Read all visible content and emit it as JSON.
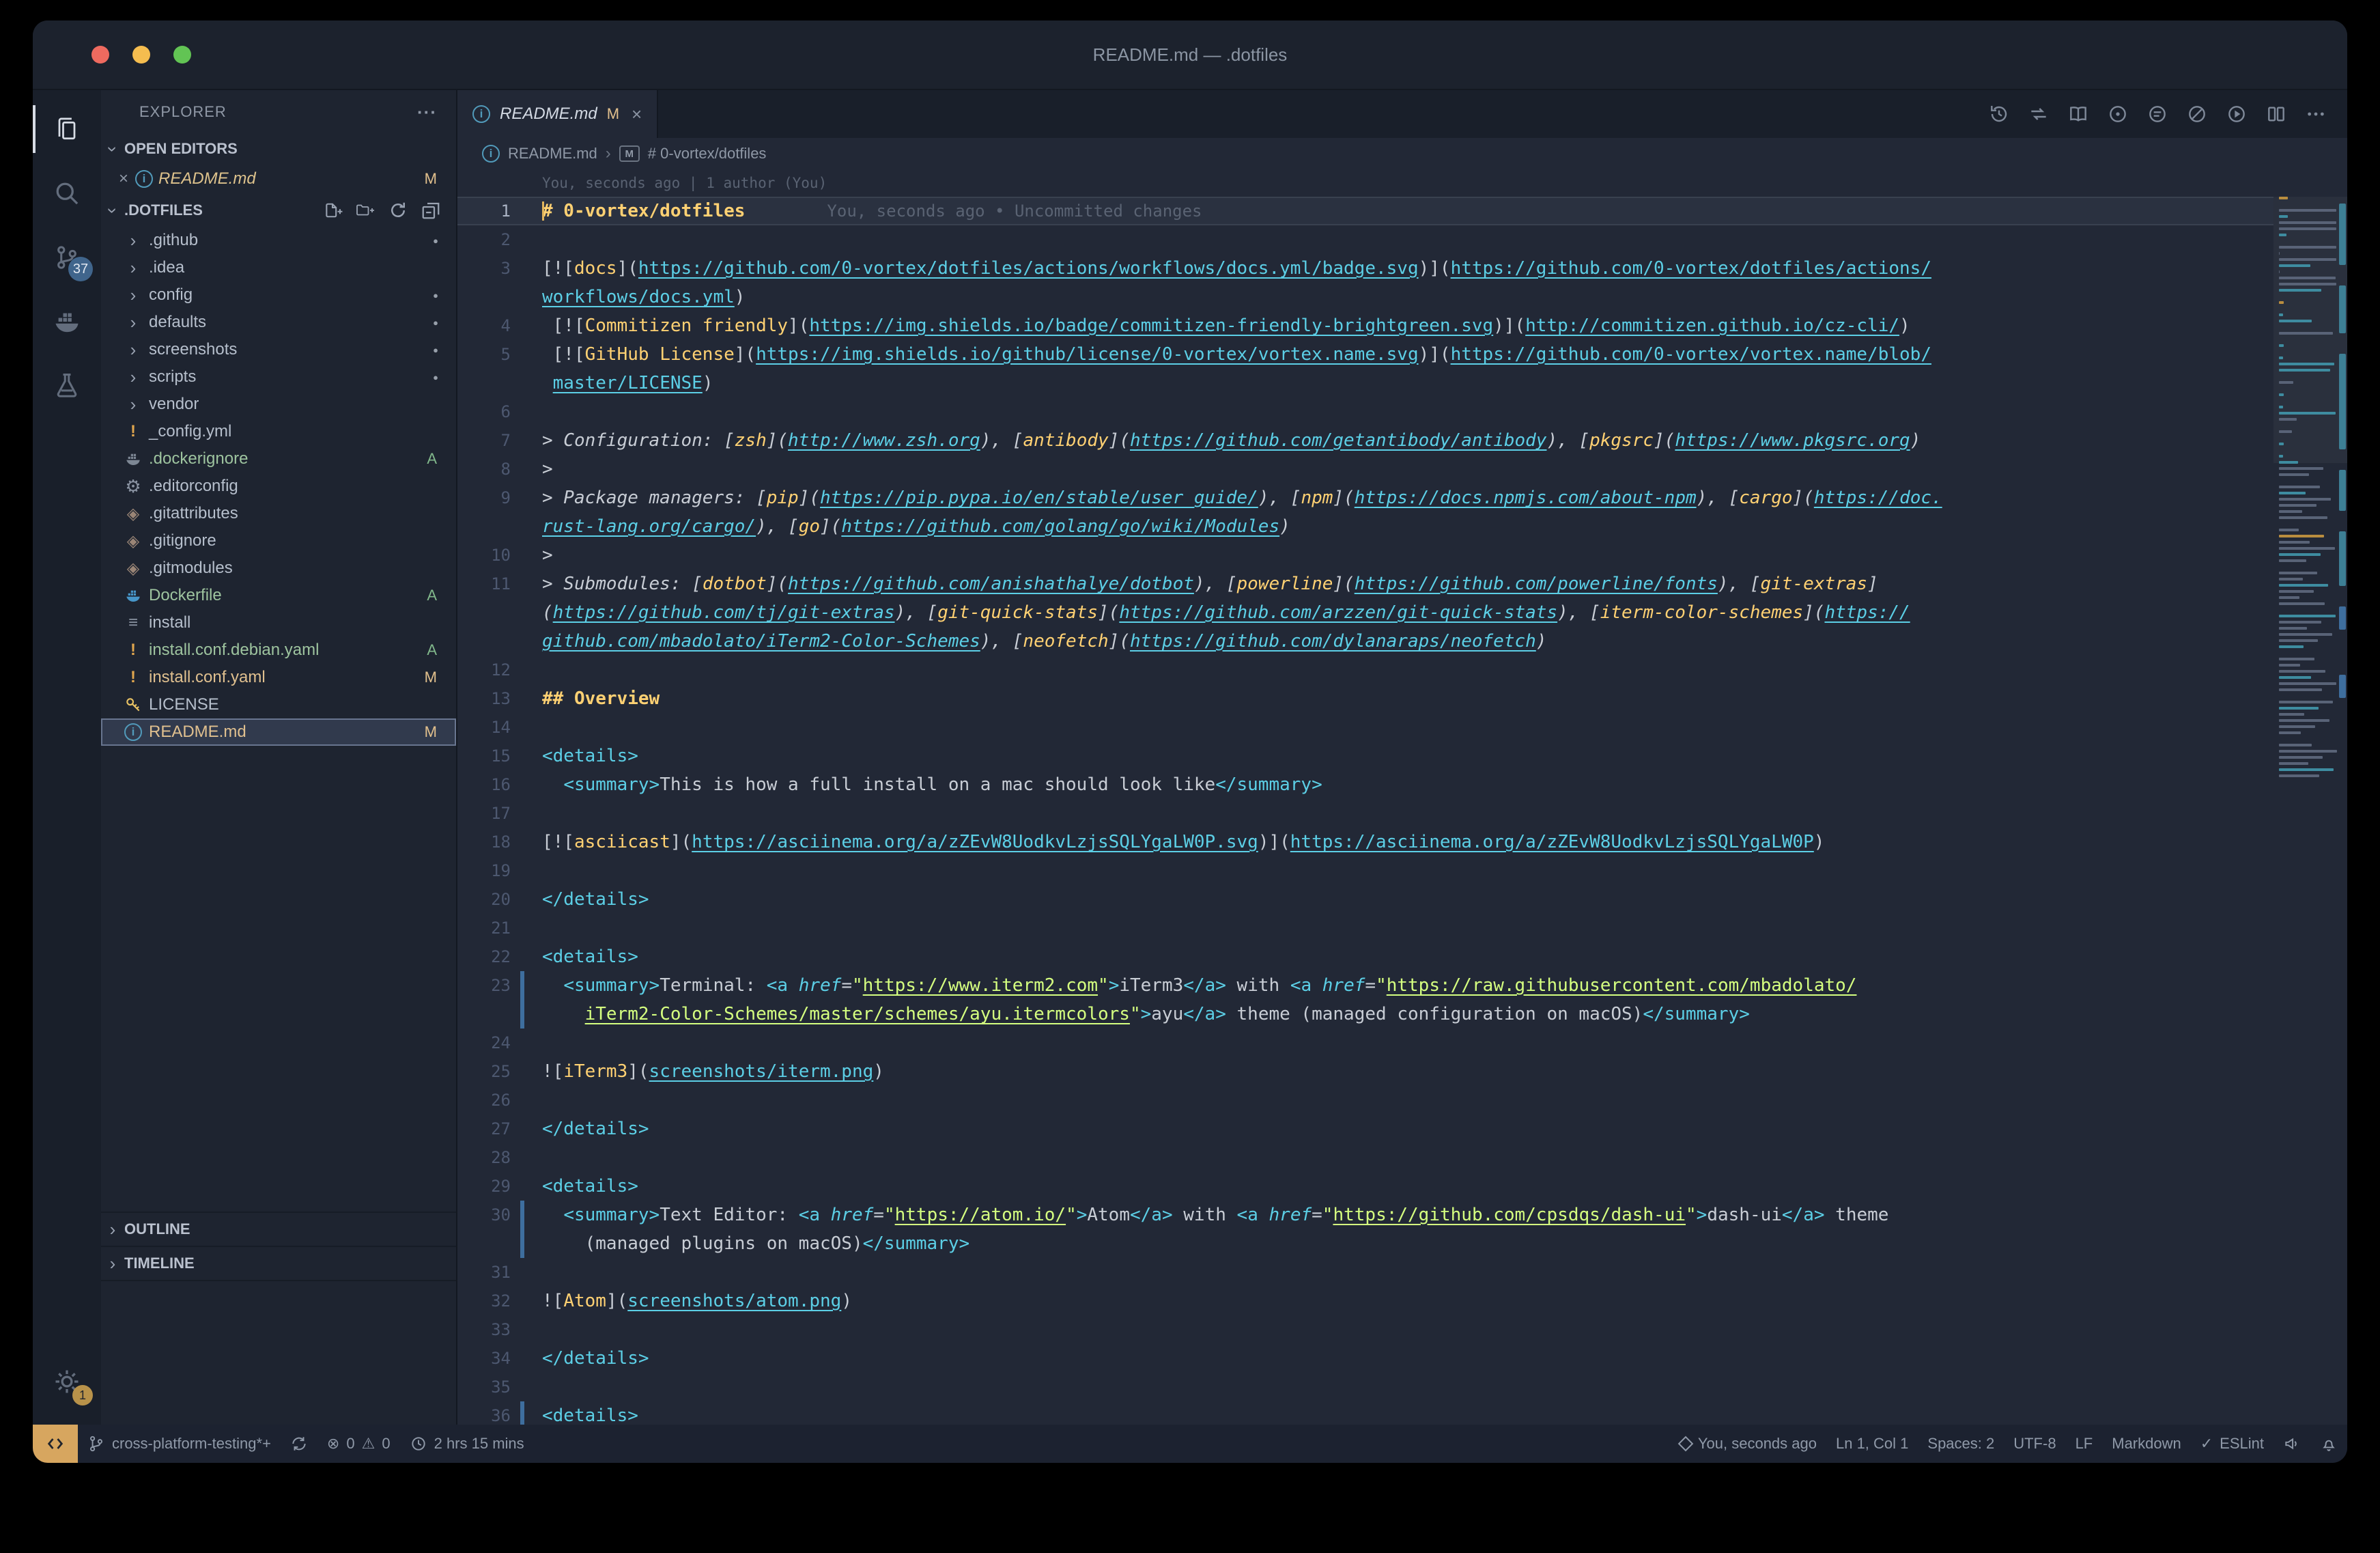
{
  "window": {
    "title": "README.md — .dotfiles"
  },
  "activity_bar": {
    "scm_badge": "37",
    "settings_badge": "1"
  },
  "sidebar": {
    "title": "EXPLORER",
    "more": "···",
    "sections": {
      "open_editors": "OPEN EDITORS",
      "folder": ".DOTFILES",
      "outline": "OUTLINE",
      "timeline": "TIMELINE"
    },
    "open_editor": {
      "name": "README.md",
      "badge": "M"
    },
    "tree": [
      {
        "label": ".github",
        "type": "folder",
        "dot": true
      },
      {
        "label": ".idea",
        "type": "folder"
      },
      {
        "label": "config",
        "type": "folder",
        "dot": true
      },
      {
        "label": "defaults",
        "type": "folder",
        "dot": true
      },
      {
        "label": "screenshots",
        "type": "folder",
        "dot": true
      },
      {
        "label": "scripts",
        "type": "folder",
        "dot": true
      },
      {
        "label": "vendor",
        "type": "folder"
      },
      {
        "label": "_config.yml",
        "icon": "yaml"
      },
      {
        "label": ".dockerignore",
        "icon": "docker-gray",
        "badge": "A"
      },
      {
        "label": ".editorconfig",
        "icon": "gear"
      },
      {
        "label": ".gitattributes",
        "icon": "git"
      },
      {
        "label": ".gitignore",
        "icon": "git"
      },
      {
        "label": ".gitmodules",
        "icon": "git"
      },
      {
        "label": "Dockerfile",
        "icon": "docker-blue",
        "badge": "A"
      },
      {
        "label": "install",
        "icon": "shell"
      },
      {
        "label": "install.conf.debian.yaml",
        "icon": "yaml",
        "badge": "A"
      },
      {
        "label": "install.conf.yaml",
        "icon": "yaml",
        "badge": "M"
      },
      {
        "label": "LICENSE",
        "icon": "key"
      },
      {
        "label": "README.md",
        "icon": "info",
        "badge": "M",
        "selected": true
      }
    ]
  },
  "editor": {
    "tab": {
      "title": "README.md",
      "badge": "M"
    },
    "breadcrumbs": {
      "file": "README.md",
      "heading": "# 0-vortex/dotfiles"
    },
    "blame_header": "You, seconds ago | 1 author (You)",
    "rows": [
      {
        "n": "1",
        "cur": true,
        "blame": "You, seconds ago • Uncommitted changes",
        "t": [
          [
            "h",
            "# 0-vortex/dotfiles"
          ]
        ]
      },
      {
        "n": "2",
        "t": []
      },
      {
        "n": "3",
        "t": [
          [
            "p",
            "[!["
          ],
          [
            "y",
            "docs"
          ],
          [
            "p",
            "]("
          ],
          [
            "u",
            "https://github.com/0-vortex/dotfiles/actions/workflows/docs.yml/badge.svg"
          ],
          [
            "p",
            ")]("
          ],
          [
            "u",
            "https://github.com/0-vortex/dotfiles/actions/"
          ]
        ]
      },
      {
        "n": "",
        "t": [
          [
            "u",
            "workflows/docs.yml"
          ],
          [
            "p",
            ")"
          ]
        ]
      },
      {
        "n": "4",
        "t": [
          [
            "p",
            " [!["
          ],
          [
            "y",
            "Commitizen friendly"
          ],
          [
            "p",
            "]("
          ],
          [
            "u",
            "https://img.shields.io/badge/commitizen-friendly-brightgreen.svg"
          ],
          [
            "p",
            ")]("
          ],
          [
            "u",
            "http://commitizen.github.io/cz-cli/"
          ],
          [
            "p",
            ")"
          ]
        ]
      },
      {
        "n": "5",
        "t": [
          [
            "p",
            " [!["
          ],
          [
            "y",
            "GitHub License"
          ],
          [
            "p",
            "]("
          ],
          [
            "u",
            "https://img.shields.io/github/license/0-vortex/vortex.name.svg"
          ],
          [
            "p",
            ")]("
          ],
          [
            "u",
            "https://github.com/0-vortex/vortex.name/blob/"
          ]
        ]
      },
      {
        "n": "",
        "t": [
          [
            "p",
            " "
          ],
          [
            "u",
            "master/LICENSE"
          ],
          [
            "p",
            ")"
          ]
        ]
      },
      {
        "n": "6",
        "t": []
      },
      {
        "n": "7",
        "q": true,
        "t": [
          [
            "p",
            "> Configuration: ["
          ],
          [
            "y",
            "zsh"
          ],
          [
            "p",
            "]("
          ],
          [
            "u",
            "http://www.zsh.org"
          ],
          [
            "p",
            "), ["
          ],
          [
            "y",
            "antibody"
          ],
          [
            "p",
            "]("
          ],
          [
            "u",
            "https://github.com/getantibody/antibody"
          ],
          [
            "p",
            "), ["
          ],
          [
            "y",
            "pkgsrc"
          ],
          [
            "p",
            "]("
          ],
          [
            "u",
            "https://www.pkgsrc.org"
          ],
          [
            "p",
            ")"
          ]
        ]
      },
      {
        "n": "8",
        "q": true,
        "t": [
          [
            "p",
            ">"
          ]
        ]
      },
      {
        "n": "9",
        "q": true,
        "t": [
          [
            "p",
            "> Package managers: ["
          ],
          [
            "y",
            "pip"
          ],
          [
            "p",
            "]("
          ],
          [
            "u",
            "https://pip.pypa.io/en/stable/user_guide/"
          ],
          [
            "p",
            "), ["
          ],
          [
            "y",
            "npm"
          ],
          [
            "p",
            "]("
          ],
          [
            "u",
            "https://docs.npmjs.com/about-npm"
          ],
          [
            "p",
            "), ["
          ],
          [
            "y",
            "cargo"
          ],
          [
            "p",
            "]("
          ],
          [
            "u",
            "https://doc."
          ]
        ]
      },
      {
        "n": "",
        "q": true,
        "t": [
          [
            "u",
            "rust-lang.org/cargo/"
          ],
          [
            "p",
            "), ["
          ],
          [
            "y",
            "go"
          ],
          [
            "p",
            "]("
          ],
          [
            "u",
            "https://github.com/golang/go/wiki/Modules"
          ],
          [
            "p",
            ")"
          ]
        ]
      },
      {
        "n": "10",
        "q": true,
        "t": [
          [
            "p",
            ">"
          ]
        ]
      },
      {
        "n": "11",
        "q": true,
        "t": [
          [
            "p",
            "> Submodules: ["
          ],
          [
            "y",
            "dotbot"
          ],
          [
            "p",
            "]("
          ],
          [
            "u",
            "https://github.com/anishathalye/dotbot"
          ],
          [
            "p",
            "), ["
          ],
          [
            "y",
            "powerline"
          ],
          [
            "p",
            "]("
          ],
          [
            "u",
            "https://github.com/powerline/fonts"
          ],
          [
            "p",
            "), ["
          ],
          [
            "y",
            "git-extras"
          ],
          [
            "p",
            "]"
          ]
        ]
      },
      {
        "n": "",
        "q": true,
        "t": [
          [
            "p",
            "("
          ],
          [
            "u",
            "https://github.com/tj/git-extras"
          ],
          [
            "p",
            "), ["
          ],
          [
            "y",
            "git-quick-stats"
          ],
          [
            "p",
            "]("
          ],
          [
            "u",
            "https://github.com/arzzen/git-quick-stats"
          ],
          [
            "p",
            "), ["
          ],
          [
            "y",
            "iterm-color-schemes"
          ],
          [
            "p",
            "]("
          ],
          [
            "u",
            "https://"
          ]
        ]
      },
      {
        "n": "",
        "q": true,
        "t": [
          [
            "u",
            "github.com/mbadolato/iTerm2-Color-Schemes"
          ],
          [
            "p",
            "), ["
          ],
          [
            "y",
            "neofetch"
          ],
          [
            "p",
            "]("
          ],
          [
            "u",
            "https://github.com/dylanaraps/neofetch"
          ],
          [
            "p",
            ")"
          ]
        ]
      },
      {
        "n": "12",
        "t": []
      },
      {
        "n": "13",
        "t": [
          [
            "h",
            "## Overview"
          ]
        ]
      },
      {
        "n": "14",
        "t": []
      },
      {
        "n": "15",
        "t": [
          [
            "t",
            "<details>"
          ]
        ]
      },
      {
        "n": "16",
        "t": [
          [
            "p",
            "  "
          ],
          [
            "t",
            "<summary>"
          ],
          [
            "p",
            "This is how a full install on a mac should look like"
          ],
          [
            "t",
            "</summary>"
          ]
        ]
      },
      {
        "n": "17",
        "t": []
      },
      {
        "n": "18",
        "t": [
          [
            "p",
            "[!["
          ],
          [
            "y",
            "asciicast"
          ],
          [
            "p",
            "]("
          ],
          [
            "u",
            "https://asciinema.org/a/zZEvW8UodkvLzjsSQLYgaLW0P.svg"
          ],
          [
            "p",
            ")]("
          ],
          [
            "u",
            "https://asciinema.org/a/zZEvW8UodkvLzjsSQLYgaLW0P"
          ],
          [
            "p",
            ")"
          ]
        ]
      },
      {
        "n": "19",
        "t": []
      },
      {
        "n": "20",
        "t": [
          [
            "t",
            "</details>"
          ]
        ]
      },
      {
        "n": "21",
        "t": []
      },
      {
        "n": "22",
        "t": [
          [
            "t",
            "<details>"
          ]
        ]
      },
      {
        "n": "23",
        "chg": true,
        "t": [
          [
            "p",
            "  "
          ],
          [
            "t",
            "<summary>"
          ],
          [
            "p",
            "Terminal: "
          ],
          [
            "t",
            "<a "
          ],
          [
            "a",
            "href"
          ],
          [
            "p",
            "="
          ],
          [
            "s",
            "\""
          ],
          [
            "su",
            "https://www.iterm2.com"
          ],
          [
            "s",
            "\""
          ],
          [
            "t",
            ">"
          ],
          [
            "p",
            "iTerm3"
          ],
          [
            "t",
            "</a>"
          ],
          [
            "p",
            " with "
          ],
          [
            "t",
            "<a "
          ],
          [
            "a",
            "href"
          ],
          [
            "p",
            "="
          ],
          [
            "s",
            "\""
          ],
          [
            "su",
            "https://raw.githubusercontent.com/mbadolato/"
          ]
        ]
      },
      {
        "n": "",
        "chg": true,
        "t": [
          [
            "p",
            "    "
          ],
          [
            "su",
            "iTerm2-Color-Schemes/master/schemes/ayu.itermcolors"
          ],
          [
            "s",
            "\""
          ],
          [
            "t",
            ">"
          ],
          [
            "p",
            "ayu"
          ],
          [
            "t",
            "</a>"
          ],
          [
            "p",
            " theme (managed configuration on macOS)"
          ],
          [
            "t",
            "</summary>"
          ]
        ]
      },
      {
        "n": "24",
        "t": []
      },
      {
        "n": "25",
        "t": [
          [
            "p",
            "!["
          ],
          [
            "y",
            "iTerm3"
          ],
          [
            "p",
            "]("
          ],
          [
            "u",
            "screenshots/iterm.png"
          ],
          [
            "p",
            ")"
          ]
        ]
      },
      {
        "n": "26",
        "t": []
      },
      {
        "n": "27",
        "t": [
          [
            "t",
            "</details>"
          ]
        ]
      },
      {
        "n": "28",
        "t": []
      },
      {
        "n": "29",
        "t": [
          [
            "t",
            "<details>"
          ]
        ]
      },
      {
        "n": "30",
        "chg": true,
        "t": [
          [
            "p",
            "  "
          ],
          [
            "t",
            "<summary>"
          ],
          [
            "p",
            "Text Editor: "
          ],
          [
            "t",
            "<a "
          ],
          [
            "a",
            "href"
          ],
          [
            "p",
            "="
          ],
          [
            "s",
            "\""
          ],
          [
            "su",
            "https://atom.io/"
          ],
          [
            "s",
            "\""
          ],
          [
            "t",
            ">"
          ],
          [
            "p",
            "Atom"
          ],
          [
            "t",
            "</a>"
          ],
          [
            "p",
            " with "
          ],
          [
            "t",
            "<a "
          ],
          [
            "a",
            "href"
          ],
          [
            "p",
            "="
          ],
          [
            "s",
            "\""
          ],
          [
            "su",
            "https://github.com/cpsdqs/dash-ui"
          ],
          [
            "s",
            "\""
          ],
          [
            "t",
            ">"
          ],
          [
            "p",
            "dash-ui"
          ],
          [
            "t",
            "</a>"
          ],
          [
            "p",
            " theme"
          ]
        ]
      },
      {
        "n": "",
        "chg": true,
        "t": [
          [
            "p",
            "    (managed plugins on macOS)"
          ],
          [
            "t",
            "</summary>"
          ]
        ]
      },
      {
        "n": "31",
        "t": []
      },
      {
        "n": "32",
        "t": [
          [
            "p",
            "!["
          ],
          [
            "y",
            "Atom"
          ],
          [
            "p",
            "]("
          ],
          [
            "u",
            "screenshots/atom.png"
          ],
          [
            "p",
            ")"
          ]
        ]
      },
      {
        "n": "33",
        "t": []
      },
      {
        "n": "34",
        "t": [
          [
            "t",
            "</details>"
          ]
        ]
      },
      {
        "n": "35",
        "t": []
      },
      {
        "n": "36",
        "chg": true,
        "t": [
          [
            "t",
            "<details>"
          ]
        ]
      }
    ]
  },
  "status_bar": {
    "branch": "cross-platform-testing*+",
    "errors": "0",
    "warnings": "0",
    "time": "2 hrs 15 mins",
    "blame": "You, seconds ago",
    "cursor": "Ln 1, Col 1",
    "indent": "Spaces: 2",
    "encoding": "UTF-8",
    "eol": "LF",
    "language": "Markdown",
    "linter": "ESLint"
  },
  "colors": {
    "accent_yellow": "#ffd173",
    "link_teal": "#5ccfe6",
    "string_green": "#d5ff80",
    "modified": "#e2c08d",
    "added": "#81b88b",
    "badge_blue": "#40658c",
    "remote_yellow": "#d7a65f"
  }
}
